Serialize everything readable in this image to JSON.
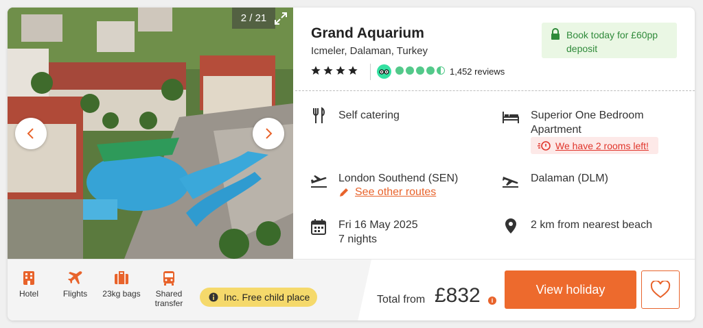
{
  "gallery": {
    "counter": "2 / 21"
  },
  "hotel": {
    "name": "Grand Aquarium",
    "location": "Icmeler, Dalaman, Turkey",
    "star_rating": 4,
    "tripadvisor_rating": 4.5,
    "reviews": "1,452 reviews"
  },
  "deposit": {
    "text_line1": "Book today for £60pp",
    "text_line2": "deposit"
  },
  "details": {
    "board": "Self catering",
    "room_line1": "Superior One Bedroom",
    "room_line2": "Apartment",
    "rooms_left": "We have 2 rooms left!",
    "departure": "London Southend (SEN)",
    "other_routes": "See other routes",
    "arrival": "Dalaman (DLM)",
    "date": "Fri 16 May 2025",
    "nights": "7 nights",
    "beach": "2 km from nearest beach"
  },
  "inclusions": [
    {
      "label": "Hotel",
      "icon": "hotel-icon"
    },
    {
      "label": "Flights",
      "icon": "plane-icon"
    },
    {
      "label": "23kg bags",
      "icon": "luggage-icon"
    },
    {
      "label_line1": "Shared",
      "label_line2": "transfer",
      "icon": "bus-icon"
    }
  ],
  "child_place": "Inc. Free child place",
  "price": {
    "label": "Total from",
    "amount": "£832"
  },
  "actions": {
    "view": "View holiday"
  },
  "colors": {
    "accent": "#ed6a2d",
    "green": "#2f8a3a",
    "tripadvisor": "#34e0a1",
    "badge_yellow": "#f5d96b"
  }
}
